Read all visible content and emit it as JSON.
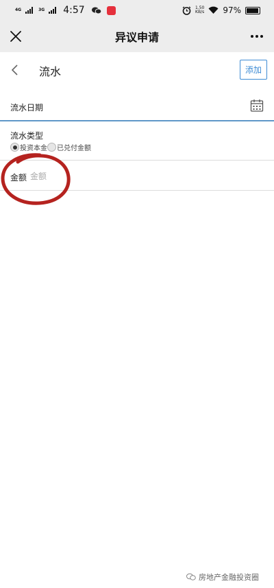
{
  "status_bar": {
    "network_1": "4G",
    "network_2": "3G",
    "time": "4:57",
    "speed_value": "1.50",
    "speed_unit": "KB/s",
    "battery": "97%"
  },
  "nav": {
    "title": "异议申请"
  },
  "page": {
    "title": "流水",
    "add_label": "添加"
  },
  "form": {
    "date_label": "流水日期",
    "type_label": "流水类型",
    "type_options": [
      "投资本金",
      "已兑付金额"
    ],
    "type_selected": "投资本金",
    "amount_label": "金额",
    "amount_placeholder": "金额"
  },
  "annotation": {
    "color": "#b5231f"
  },
  "watermark": {
    "text": "房地产金融投资圈"
  },
  "colors": {
    "accent": "#3d8bd4",
    "active_underline": "#5f97c8"
  }
}
